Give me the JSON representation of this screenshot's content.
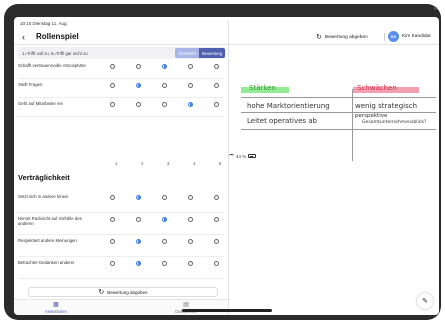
{
  "status": {
    "time": "10:15  Dienstag 11. Aug.",
    "battery": "44 %"
  },
  "header": {
    "back_icon": "chevron-left",
    "title": "Rollenspiel",
    "bewertung_label": "Bewertung abgeben",
    "user_initials": "KK",
    "user_name": "Kim Kandidat"
  },
  "scale": {
    "hint": "1=Trifft voll zu, 5=Trifft gar nicht zu",
    "seg_overview": "Übersicht",
    "seg_rating": "Bewertung"
  },
  "columns": [
    "1",
    "2",
    "3",
    "4",
    "5"
  ],
  "rows_top": [
    {
      "label": "Schafft vertrauensvolle Atmosphäre",
      "selected": 3
    },
    {
      "label": "Stellt Fragen",
      "selected": 2
    },
    {
      "label": "Geht auf Mitarbeiter ein",
      "selected": 4
    }
  ],
  "section_title": "Verträglichkeit",
  "rows_bottom": [
    {
      "label": "Setzt sich in andere hinein",
      "selected": 2
    },
    {
      "label": "Nimmt Rücksicht auf Gefühle des anderen",
      "selected": 3
    },
    {
      "label": "Respektiert andere Meinungen",
      "selected": 2
    },
    {
      "label": "Betrachtet Gedanken anderer",
      "selected": 2
    }
  ],
  "bottom_button": "Bewertung abgeben",
  "tabs": [
    {
      "label": "Assessoren",
      "icon": "grid-icon",
      "active": true
    },
    {
      "label": "Dokumente",
      "icon": "document-icon",
      "active": false
    }
  ],
  "notes": {
    "staerken": "Stärken",
    "schwaechen": "Schwächen",
    "left_line1": "hohe Marktorientierung",
    "left_line2": "Leitet operatives ab",
    "right_line1": "wenig strategisch",
    "right_line2a": "perspektive",
    "right_line2b": "Gesamtunternehmensblick?"
  },
  "colors": {
    "accent": "#4f5fb0",
    "radio": "#3b7be0",
    "green": "#95ea95",
    "red": "#f5a0b0"
  }
}
